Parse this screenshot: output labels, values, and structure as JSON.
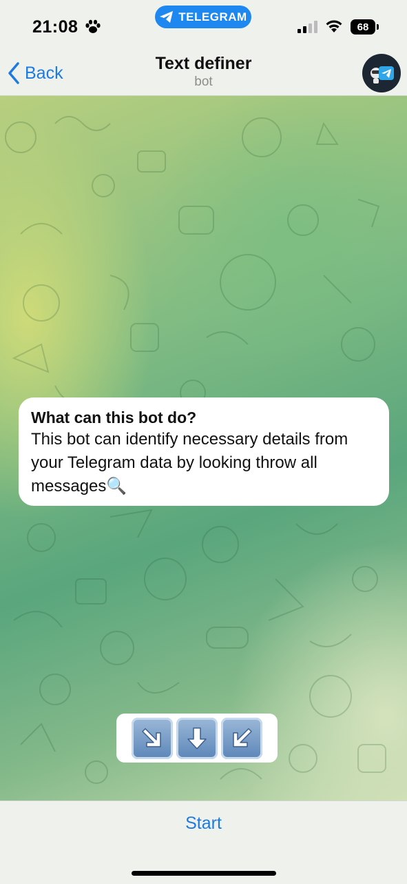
{
  "status_bar": {
    "time": "21:08",
    "pill_label": "TELEGRAM",
    "battery": "68"
  },
  "header": {
    "back_label": "Back",
    "title": "Text definer",
    "subtitle": "bot"
  },
  "info_card": {
    "title": "What can this bot do?",
    "body": "This bot can identify necessary details from your Telegram data by looking throw all messages🔍"
  },
  "arrows": [
    "↘️",
    "⬇️",
    "↙️"
  ],
  "bottom": {
    "start_label": "Start"
  },
  "colors": {
    "accent": "#1f7ae0",
    "pill": "#1f87f0",
    "bar_bg": "#eef1ec"
  }
}
